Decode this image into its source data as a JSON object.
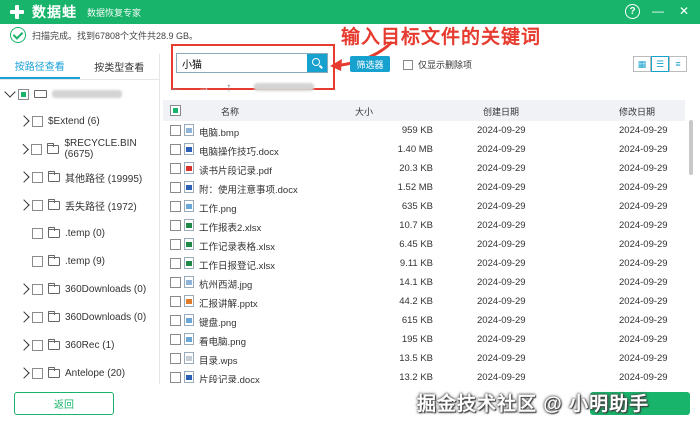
{
  "titlebar": {
    "app_name": "数据蛙",
    "subtitle": "数据恢复专家",
    "help_label": "?",
    "minimize_label": "—",
    "close_label": "✕"
  },
  "status": {
    "text": "扫描完成。找到67808个文件共28.9 GB。"
  },
  "annotation": "输入目标文件的关键词",
  "left_tabs": [
    {
      "label": "按路径查看",
      "active": true
    },
    {
      "label": "按类型查看",
      "active": false
    }
  ],
  "tree": [
    {
      "label": "",
      "expanded": true,
      "type": "drive"
    },
    {
      "label": "$Extend (6)",
      "type": "folder",
      "expandable": true
    },
    {
      "label": "$RECYCLE.BIN (6675)",
      "type": "folder",
      "expandable": true
    },
    {
      "label": "其他路径 (19995)",
      "type": "folder",
      "expandable": true
    },
    {
      "label": "丢失路径 (1972)",
      "type": "folder",
      "expandable": true
    },
    {
      "label": ".temp (0)",
      "type": "folder",
      "expandable": false
    },
    {
      "label": ".temp (9)",
      "type": "folder",
      "expandable": false
    },
    {
      "label": "360Downloads (0)",
      "type": "folder",
      "expandable": true
    },
    {
      "label": "360Downloads (0)",
      "type": "folder",
      "expandable": true
    },
    {
      "label": "360Rec (1)",
      "type": "folder",
      "expandable": true
    },
    {
      "label": "Antelope (20)",
      "type": "folder",
      "expandable": true
    }
  ],
  "back_button": "返回",
  "search": {
    "value": "小猫"
  },
  "filter_button": "筛选器",
  "show_deleted_label": "仅显示删除项",
  "nav": {
    "back": "←",
    "forward": "→",
    "up": "↑"
  },
  "columns": {
    "name": "名称",
    "size": "大小",
    "created": "创建日期",
    "modified": "修改日期"
  },
  "files": [
    {
      "name": "电脑.bmp",
      "size": "959 KB",
      "created": "2024-09-29",
      "modified": "2024-09-29",
      "color": "#8fb3d9"
    },
    {
      "name": "电脑操作技巧.docx",
      "size": "1.40 MB",
      "created": "2024-09-29",
      "modified": "2024-09-29",
      "color": "#2b5fb8"
    },
    {
      "name": "读书片段记录.pdf",
      "size": "20.3 KB",
      "created": "2024-09-29",
      "modified": "2024-09-29",
      "color": "#d9322b"
    },
    {
      "name": "附：使用注意事项.docx",
      "size": "1.52 MB",
      "created": "2024-09-29",
      "modified": "2024-09-29",
      "color": "#2b5fb8"
    },
    {
      "name": "工作.png",
      "size": "635 KB",
      "created": "2024-09-29",
      "modified": "2024-09-29",
      "color": "#6aa6d6"
    },
    {
      "name": "工作报表2.xlsx",
      "size": "10.7 KB",
      "created": "2024-09-29",
      "modified": "2024-09-29",
      "color": "#1f8a48"
    },
    {
      "name": "工作记录表格.xlsx",
      "size": "6.45 KB",
      "created": "2024-09-29",
      "modified": "2024-09-29",
      "color": "#1f8a48"
    },
    {
      "name": "工作日报登记.xlsx",
      "size": "9.11 KB",
      "created": "2024-09-29",
      "modified": "2024-09-29",
      "color": "#1f8a48"
    },
    {
      "name": "杭州西湖.jpg",
      "size": "14.1 KB",
      "created": "2024-09-29",
      "modified": "2024-09-29",
      "color": "#8fb3d9"
    },
    {
      "name": "汇报讲解.pptx",
      "size": "44.2 KB",
      "created": "2024-09-29",
      "modified": "2024-09-29",
      "color": "#e07b2a"
    },
    {
      "name": "键盘.png",
      "size": "615 KB",
      "created": "2024-09-29",
      "modified": "2024-09-29",
      "color": "#6aa6d6"
    },
    {
      "name": "看电脑.png",
      "size": "195 KB",
      "created": "2024-09-29",
      "modified": "2024-09-29",
      "color": "#6aa6d6"
    },
    {
      "name": "目录.wps",
      "size": "13.5 KB",
      "created": "2024-09-29",
      "modified": "2024-09-29",
      "color": "#c4ccd6"
    },
    {
      "name": "片段记录.docx",
      "size": "13.2 KB",
      "created": "2024-09-29",
      "modified": "2024-09-29",
      "color": "#2b5fb8"
    }
  ],
  "watermark": "掘金技术社区 @ 小明助手",
  "colors": {
    "brand": "#18b46b",
    "accent": "#17a1cf",
    "annotation": "#e63b2e"
  }
}
